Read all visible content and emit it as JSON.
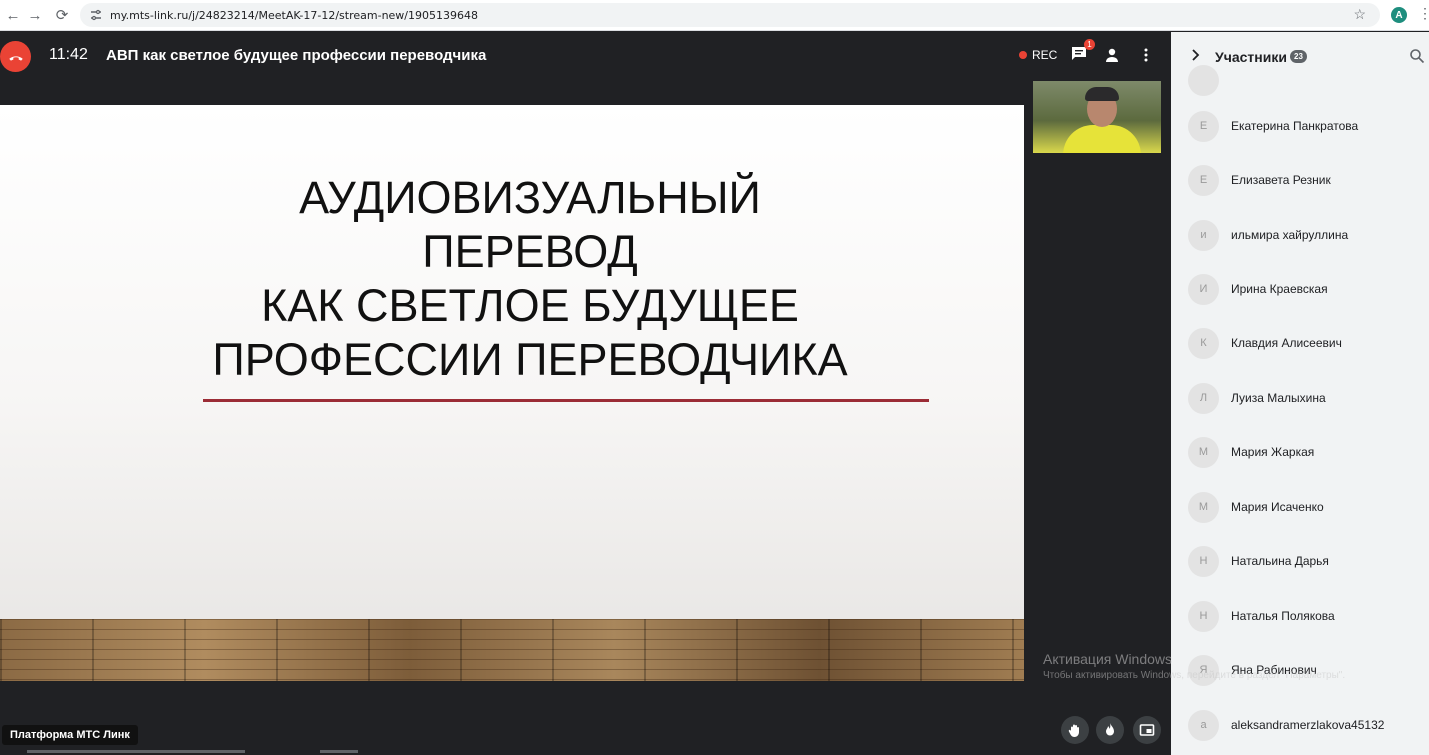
{
  "browser": {
    "url": "my.mts-link.ru/j/24823214/MeetAK-17-12/stream-new/1905139648",
    "profile_initial": "A"
  },
  "meeting": {
    "time": "11:42",
    "title": "АВП как светлое будущее профессии переводчика",
    "rec_label": "REC",
    "chat_badge": "1",
    "platform_label": "Платформа МТС Линк"
  },
  "slide": {
    "lines": [
      "АУДИОВИЗУАЛЬНЫЙ",
      "ПЕРЕВОД",
      "КАК СВЕТЛОЕ БУДУЩЕЕ",
      "ПРОФЕССИИ ПЕРЕВОДЧИКА"
    ],
    "rule_color": "#9b2c36"
  },
  "watermark": {
    "title": "Активация Windows",
    "subtitle": "Чтобы активировать Windows, перейдите в раздел \"Параметры\"."
  },
  "sidebar": {
    "title": "Участники",
    "count": "23",
    "participants": [
      {
        "initial": "Е",
        "name": "Екатерина Панкратова"
      },
      {
        "initial": "Е",
        "name": "Елизавета Резник"
      },
      {
        "initial": "и",
        "name": "ильмира хайруллина"
      },
      {
        "initial": "И",
        "name": "Ирина Краевская"
      },
      {
        "initial": "К",
        "name": "Клавдия Алисеевич"
      },
      {
        "initial": "Л",
        "name": "Луиза Малыхина"
      },
      {
        "initial": "М",
        "name": "Мария Жаркая"
      },
      {
        "initial": "М",
        "name": "Мария Исаченко"
      },
      {
        "initial": "Н",
        "name": "Натальина Дарья"
      },
      {
        "initial": "Н",
        "name": "Наталья Полякова"
      },
      {
        "initial": "Я",
        "name": "Яна Рабинович"
      },
      {
        "initial": "a",
        "name": "aleksandramerzlakova45132"
      }
    ]
  },
  "colors": {
    "hangup": "#ea4335",
    "rec_dot": "#ea4335",
    "sidebar_bg": "#f1f3f4",
    "meeting_bg": "#202124"
  }
}
